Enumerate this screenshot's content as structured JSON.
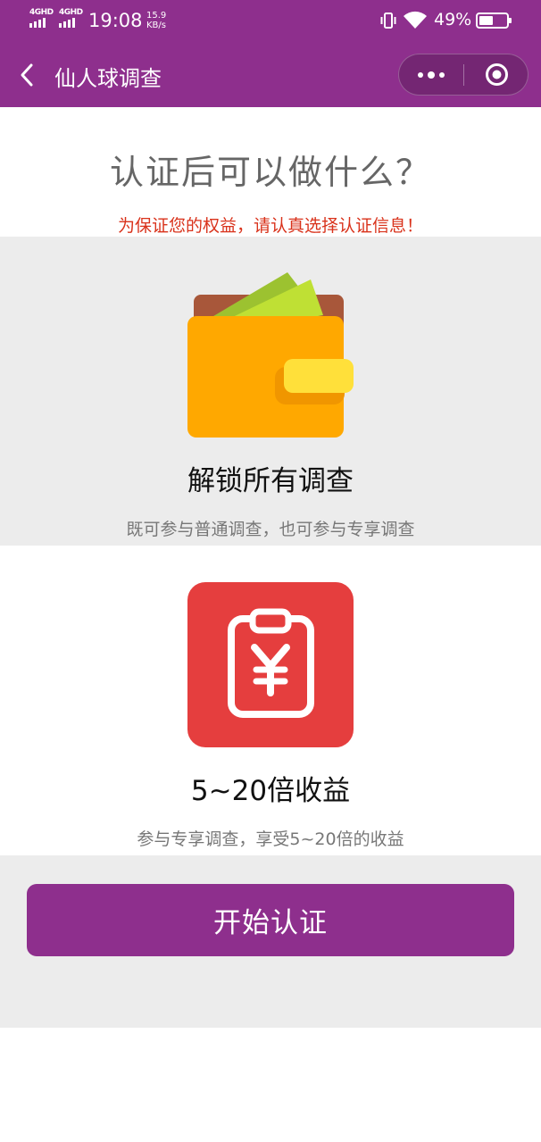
{
  "status_bar": {
    "signal1_label": "4GHD",
    "signal2_label": "4GHD",
    "time": "19:08",
    "net_speed_value": "15.9",
    "net_speed_unit": "KB/s",
    "battery_percent": "49%",
    "battery_level": 0.49,
    "icons": [
      "signal-icon",
      "vibrate-icon",
      "wifi-icon",
      "battery-icon"
    ]
  },
  "nav": {
    "title": "仙人球调查",
    "icons": [
      "back-icon",
      "more-icon",
      "close-icon"
    ]
  },
  "header": {
    "title": "认证后可以做什么？",
    "notice": "为保证您的权益，请认真选择认证信息！"
  },
  "features": [
    {
      "icon": "wallet-icon",
      "title": "解锁所有调查",
      "description": "既可参与普通调查，也可参与专享调查"
    },
    {
      "icon": "clipboard-yen-icon",
      "title": "5~20倍收益",
      "description": "参与专享调查，享受5~20倍的收益"
    }
  ],
  "cta": {
    "label": "开始认证"
  },
  "colors": {
    "brand_purple": "#8e2f8d",
    "notice_red": "#d9321b",
    "section_gray": "#ececec",
    "wallet_orange": "#ffa800",
    "report_red": "#e53e3e"
  }
}
